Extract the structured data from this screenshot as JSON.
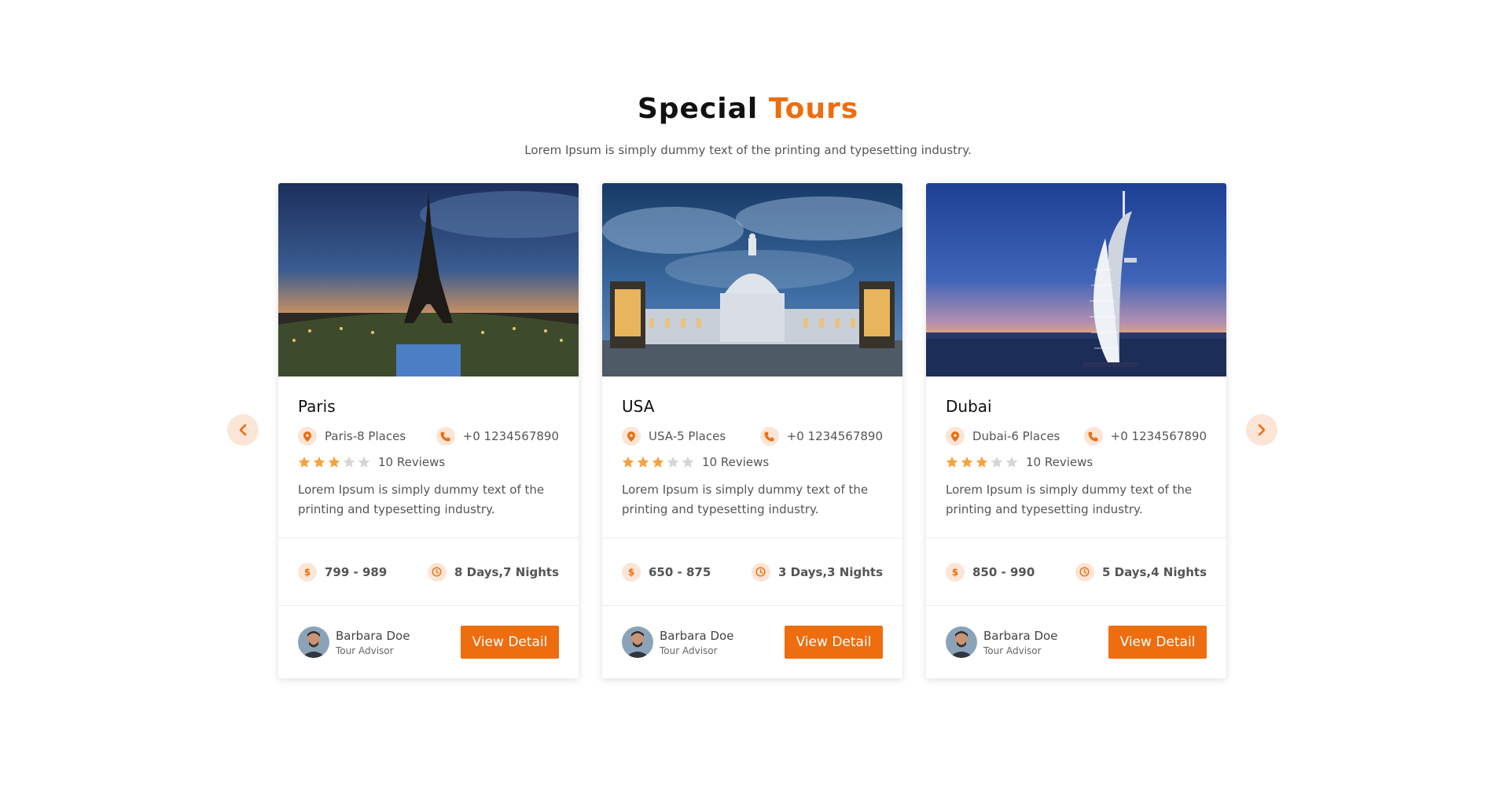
{
  "section": {
    "title_main": "Special",
    "title_accent": "Tours",
    "subtitle": "Lorem Ipsum is simply dummy text of the printing and typesetting industry."
  },
  "colors": {
    "accent": "#ee6d0e",
    "accent_soft": "#fbe5d6"
  },
  "icons": {
    "prev": "chevron-left-icon",
    "next": "chevron-right-icon",
    "location": "location-pin-icon",
    "phone": "phone-icon",
    "price": "dollar-icon",
    "duration": "clock-icon"
  },
  "tours": [
    {
      "name": "Paris",
      "places": "Paris-8 Places",
      "phone": "+0 1234567890",
      "rating": 3,
      "reviews": "10 Reviews",
      "description": "Lorem Ipsum is simply dummy text of the printing and typesetting industry.",
      "price": "799 - 989",
      "duration": "8 Days,7 Nights",
      "advisor_name": "Barbara Doe",
      "advisor_role": "Tour Advisor",
      "button": "View Detail"
    },
    {
      "name": "USA",
      "places": "USA-5 Places",
      "phone": "+0 1234567890",
      "rating": 3,
      "reviews": "10 Reviews",
      "description": "Lorem Ipsum is simply dummy text of the printing and typesetting industry.",
      "price": "650 - 875",
      "duration": "3 Days,3 Nights",
      "advisor_name": "Barbara Doe",
      "advisor_role": "Tour Advisor",
      "button": "View Detail"
    },
    {
      "name": "Dubai",
      "places": "Dubai-6 Places",
      "phone": "+0 1234567890",
      "rating": 3,
      "reviews": "10 Reviews",
      "description": "Lorem Ipsum is simply dummy text of the printing and typesetting industry.",
      "price": "850 - 990",
      "duration": "5 Days,4 Nights",
      "advisor_name": "Barbara Doe",
      "advisor_role": "Tour Advisor",
      "button": "View Detail"
    }
  ]
}
